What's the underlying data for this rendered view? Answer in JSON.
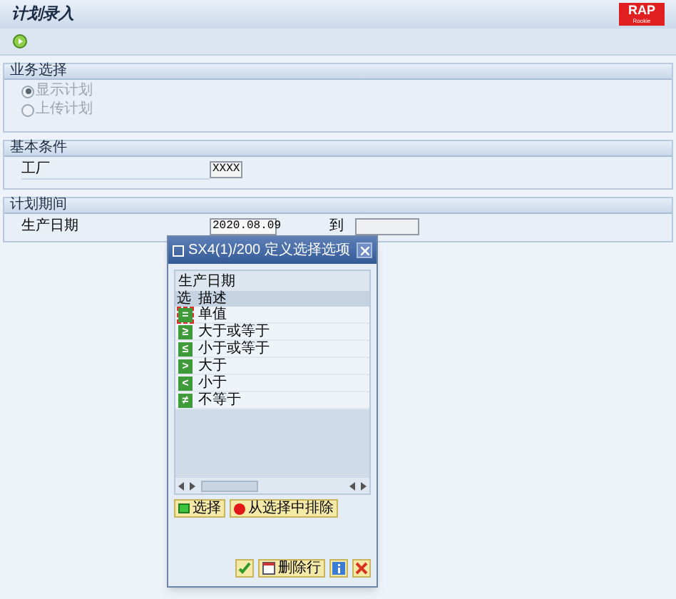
{
  "window": {
    "title": "计划录入"
  },
  "logo": {
    "text": "RAP",
    "subtext": "Rookie"
  },
  "groups": [
    {
      "title": "业务选择",
      "kind": "radios",
      "options": [
        {
          "label": "显示计划",
          "selected": true,
          "disabled": true
        },
        {
          "label": "上传计划",
          "selected": false,
          "disabled": true
        }
      ]
    },
    {
      "title": "基本条件",
      "kind": "fields",
      "fields": [
        {
          "label": "工厂",
          "value": "XXXX"
        }
      ]
    },
    {
      "title": "计划期间",
      "kind": "range",
      "fields": [
        {
          "label": "生产日期",
          "value": "2020.08.09",
          "to_label": "到"
        }
      ]
    }
  ],
  "dialog": {
    "title": "SX4(1)/200 定义选择选项",
    "table_title": "生产日期",
    "columns": [
      "选",
      "描述"
    ],
    "rows": [
      {
        "symbol": "=",
        "label": "单值",
        "selected": true
      },
      {
        "symbol": "≥",
        "label": "大于或等于",
        "selected": false
      },
      {
        "symbol": "≤",
        "label": "小于或等于",
        "selected": false
      },
      {
        "symbol": ">",
        "label": "大于",
        "selected": false
      },
      {
        "symbol": "<",
        "label": "小于",
        "selected": false
      },
      {
        "symbol": "≠",
        "label": "不等于",
        "selected": false
      }
    ],
    "mode_buttons": [
      {
        "label": "选择",
        "kind": "include"
      },
      {
        "label": "从选择中排除",
        "kind": "exclude"
      }
    ],
    "footer_buttons": [
      {
        "kind": "confirm"
      },
      {
        "kind": "delete",
        "label": "删除行"
      },
      {
        "kind": "info"
      },
      {
        "kind": "cancel"
      }
    ]
  }
}
